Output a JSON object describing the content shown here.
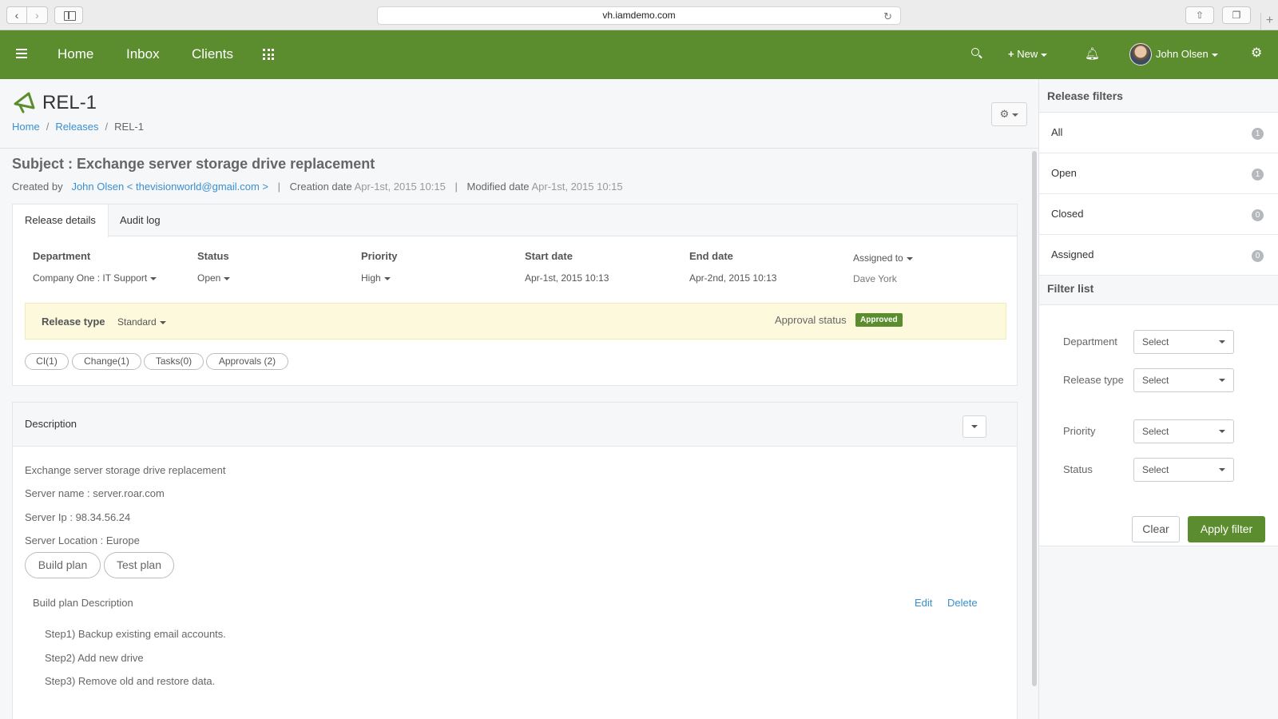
{
  "browser": {
    "url": "vh.iamdemo.com"
  },
  "nav": {
    "links": [
      "Home",
      "Inbox",
      "Clients"
    ],
    "new_label": "New",
    "user_name": "John Olsen"
  },
  "header": {
    "title": "REL-1",
    "breadcrumb": [
      "Home",
      "Releases",
      "REL-1"
    ]
  },
  "release": {
    "subject": "Subject : Exchange server storage drive replacement",
    "created_by_label": "Created by",
    "created_by": "John Olsen < thevisionworld@gmail.com >",
    "creation_label": "Creation date",
    "creation_date": "Apr-1st, 2015 10:15",
    "modified_label": "Modified date",
    "modified_date": "Apr-1st, 2015 10:15",
    "tabs": [
      "Release details",
      "Audit log"
    ],
    "fields": {
      "department_label": "Department",
      "department": "Company One : IT Support",
      "status_label": "Status",
      "status": "Open",
      "priority_label": "Priority",
      "priority": "High",
      "start_label": "Start date",
      "start": "Apr-1st, 2015 10:13",
      "end_label": "End date",
      "end": "Apr-2nd, 2015 10:13",
      "assigned_label": "Assigned to",
      "assigned": "Dave York"
    },
    "release_type_label": "Release type",
    "release_type": "Standard",
    "approval_label": "Approval status",
    "approval": "Approved",
    "pills": [
      "CI(1)",
      "Change(1)",
      "Tasks(0)",
      "Approvals (2)"
    ]
  },
  "description": {
    "title": "Description",
    "lines": [
      "Exchange server storage drive replacement",
      "Server name : server.roar.com",
      "Server Ip : 98.34.56.24",
      "Server Location : Europe"
    ],
    "plan_buttons": [
      "Build plan",
      "Test plan"
    ],
    "plan_title": "Build plan Description",
    "edit": "Edit",
    "delete": "Delete",
    "steps": [
      "Step1) Backup existing email accounts.",
      "Step2) Add new drive",
      "Step3) Remove old and restore data."
    ]
  },
  "sidebar": {
    "filters_title": "Release filters",
    "filters": [
      {
        "label": "All",
        "count": "1"
      },
      {
        "label": "Open",
        "count": "1"
      },
      {
        "label": "Closed",
        "count": "0"
      },
      {
        "label": "Assigned",
        "count": "0"
      }
    ],
    "filter_list_title": "Filter list",
    "filter_fields": [
      {
        "label": "Department",
        "value": "Select"
      },
      {
        "label": "Release type",
        "value": "Select"
      },
      {
        "label": "Priority",
        "value": "Select"
      },
      {
        "label": "Status",
        "value": "Select"
      }
    ],
    "clear": "Clear",
    "apply": "Apply filter"
  },
  "colors": {
    "brand": "#5b8d2e",
    "link": "#3a8fd0"
  }
}
